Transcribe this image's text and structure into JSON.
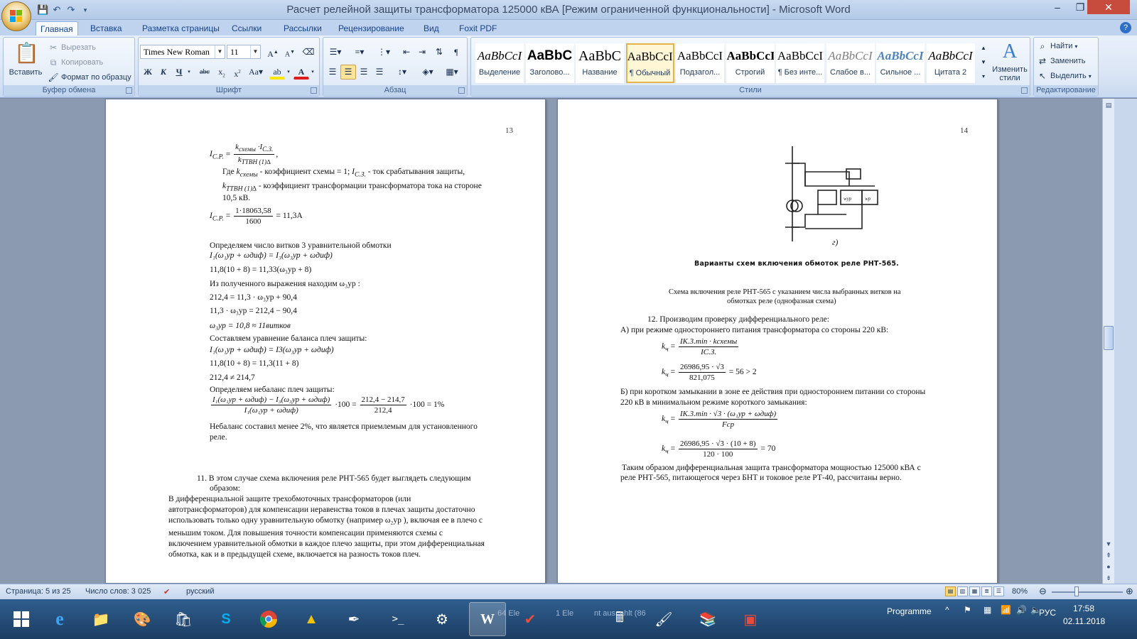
{
  "window": {
    "title": "Расчет релейной защиты трансформатора 125000 кВА [Режим ограниченной функциональности] - Microsoft Word"
  },
  "ribbon_tabs": [
    "Главная",
    "Вставка",
    "Разметка страницы",
    "Ссылки",
    "Рассылки",
    "Рецензирование",
    "Вид",
    "Foxit PDF"
  ],
  "clipboard": {
    "paste": "Вставить",
    "cut": "Вырезать",
    "copy": "Копировать",
    "format_painter": "Формат по образцу",
    "label": "Буфер обмена"
  },
  "font": {
    "name": "Times New Roman",
    "size": "11",
    "label": "Шрифт"
  },
  "paragraph": {
    "label": "Абзац"
  },
  "styles": {
    "label": "Стили",
    "items": [
      {
        "sample": "AaBbCcI",
        "name": "Выделение"
      },
      {
        "sample": "AaBbC",
        "name": "Заголово..."
      },
      {
        "sample": "AaBbC",
        "name": "Название"
      },
      {
        "sample": "AaBbCcI",
        "name": "¶ Обычный"
      },
      {
        "sample": "AaBbCcI",
        "name": "Подзагол..."
      },
      {
        "sample": "AaBbCcI",
        "name": "Строгий"
      },
      {
        "sample": "AaBbCcI",
        "name": "¶ Без инте..."
      },
      {
        "sample": "AaBbCcI",
        "name": "Слабое в..."
      },
      {
        "sample": "AaBbCcI",
        "name": "Сильное ..."
      },
      {
        "sample": "AaBbCcI",
        "name": "Цитата 2"
      }
    ],
    "change": "Изменить стили"
  },
  "editing": {
    "label": "Редактирование",
    "find": "Найти",
    "replace": "Заменить",
    "select": "Выделить"
  },
  "page13": {
    "number": "13",
    "l1": ",",
    "l2": "Где",
    "l2b": "- коэффициент схемы = 1;",
    "l2c": "- ток срабатывания защиты,",
    "l3": "- коэффициент трансформации трансформатора тока на стороне",
    "l4": "10,5 кВ.",
    "l5num": "1·18063,58",
    "l5den": "1600",
    "l5res": "= 11,3A",
    "l6": "Определяем число витков 3 уравнительной обмотки",
    "l7": "I₁(ω₁ур + ωдиф) = I₃(ω₃ур + ωдиф)",
    "l8": "11,8(10 + 8) = 11,33(ω₃ур + 8)",
    "l9": "Из полученного выражения находим ω₃ур :",
    "l10": "212,4 = 11,3 · ω₃ур + 90,4",
    "l11": "11,3 · ω₃ур = 212,4 − 90,4",
    "l12": "ω₃ур = 10,8 ≈ 11витков",
    "l13": "Составляем уравнение баланса плеч защиты:",
    "l14": "I₁(ω₁ур + ωдиф) = I3(ω₃ур + ωдиф)",
    "l15": "11,8(10 + 8) = 11,3(11 + 8)",
    "l16": "212,4 ≠ 214,7",
    "l17": "Определяем небаланс плеч защиты:",
    "l18num": "I₁(ω₁ур + ωдиф) − I₃(ω₃ур + ωдиф)",
    "l18den": "I₁(ω₁ур + ωдиф)",
    "l18mid": "·100 =",
    "l18num2": "212,4 − 214,7",
    "l18den2": "212,4",
    "l18res": "·100 = 1%",
    "l19": "Небаланс составил менее 2%, что является приемлемым для установленного",
    "l20": "реле.",
    "l21": "11. В этом случае схема включения реле РНТ-565 будет выглядеть следующим",
    "l22": "образом:",
    "l23": "В дифференциальной защите трехобмоточных трансформаторов (или",
    "l24": "автотрансформаторов) для компенсации неравенства токов в плечах защиты достаточно",
    "l25": "использовать только одну уравнительную обмотку (например ω₂ур ), включая ее в плечо с",
    "l26": "меньшим током. Для повышения точности компенсации применяются схемы с",
    "l27": "включением уравнительной обмотки в каждое плечо защиты, при этом дифференциальная",
    "l28": "обмотка, как и в предыдущей схеме, включается на разность токов плеч."
  },
  "page14": {
    "number": "14",
    "fig_letter": "г)",
    "fig_caption": "Варианты   схем включения обмоток реле РНТ-565.",
    "cap1": "Схема включения реле РНТ-565 с указанием числа выбранных витков на",
    "cap2": "обмотках реле (однофазная схема)",
    "l1": "12. Производим проверку дифференциального реле:",
    "l2": "А) при режиме одностороннего питания трансформатора со стороны 220 кВ:",
    "f1num": "IК.3.min · kсхемы",
    "f1den": "IС.З.",
    "f2num": "26986,95 · √3",
    "f2den": "821,075",
    "f2res": "= 56 > 2",
    "l3": "Б) при коротком замыкании в зоне ее действия при одностороннем питании со стороны",
    "l4": "220 кВ в минимальном режиме короткого замыкания:",
    "f3num": "IК.3.min · √3 · (ω₁ур + ωдиф)",
    "f3den": "Fср",
    "f4num": "26986,95 · √3 · (10 + 8)",
    "f4den": "120 · 100",
    "f4res": "= 70",
    "l5": "Таким образом дифференциальная защита трансформатора мощностью 125000 кВА  с",
    "l6": "реле РНТ-565, питающегося через БНТ и токовое реле РТ-40, рассчитаны верно."
  },
  "statusbar": {
    "page": "Страница: 5 из 25",
    "words": "Число слов: 3 025",
    "lang": "русский",
    "zoom": "80%"
  },
  "taskbar": {
    "programme": "Programme",
    "lang": "РУС",
    "time": "17:58",
    "date": "02.11.2018",
    "ghost1": "64 Ele",
    "ghost2": "1 Ele",
    "ghost3": "nt aus",
    "ghost4": "ahlt (86"
  }
}
